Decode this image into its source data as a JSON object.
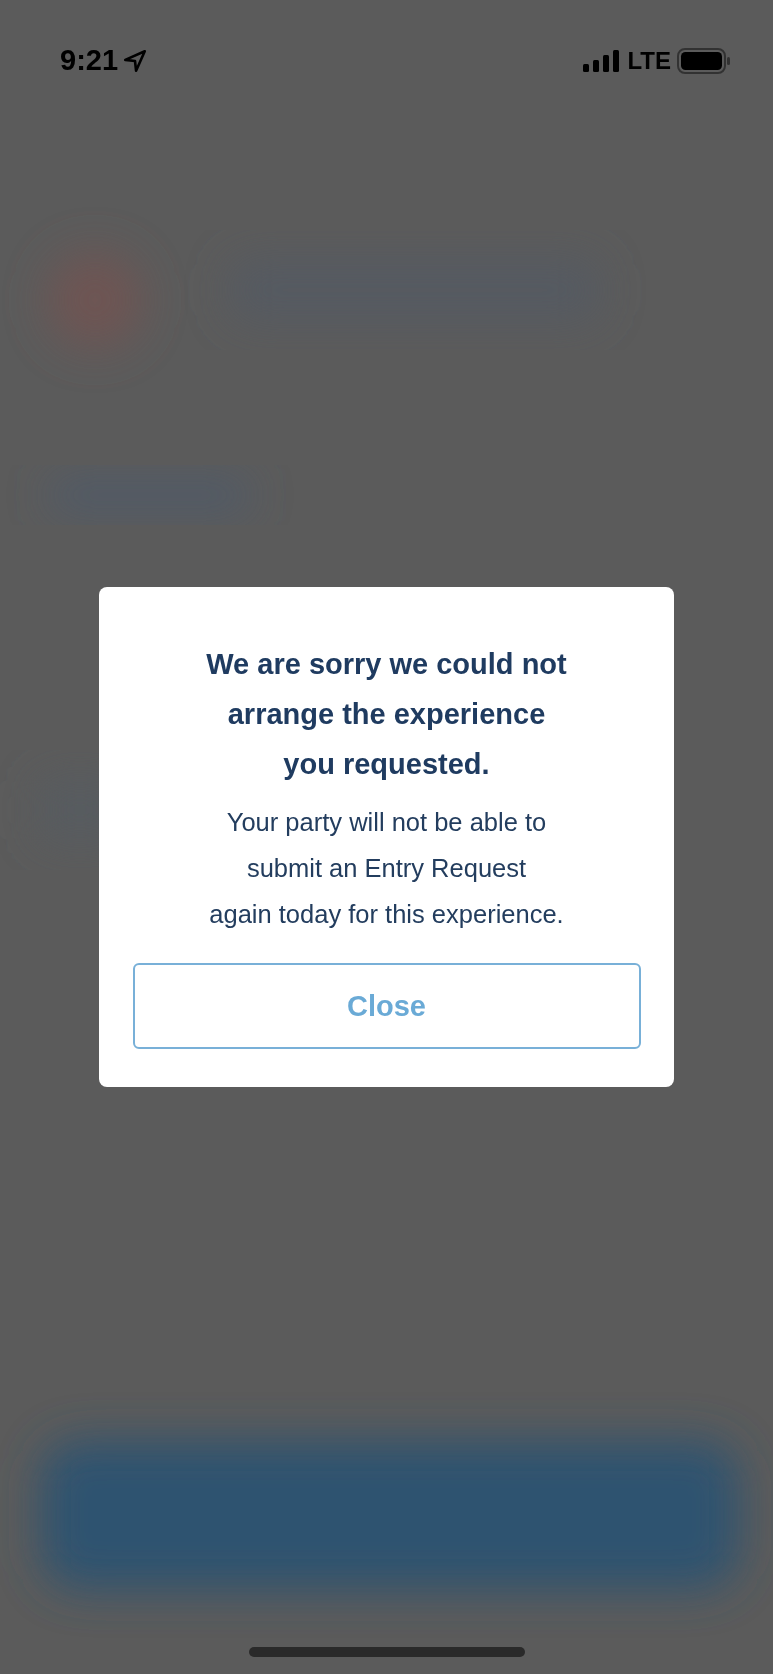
{
  "status_bar": {
    "time": "9:21",
    "network": "LTE"
  },
  "dialog": {
    "title_lines": [
      "We are sorry we could not",
      "arrange the experience",
      "you requested."
    ],
    "message_lines": [
      "Your party will not be able to",
      "submit an Entry Request",
      "again today for this experience."
    ],
    "button": "Close"
  }
}
